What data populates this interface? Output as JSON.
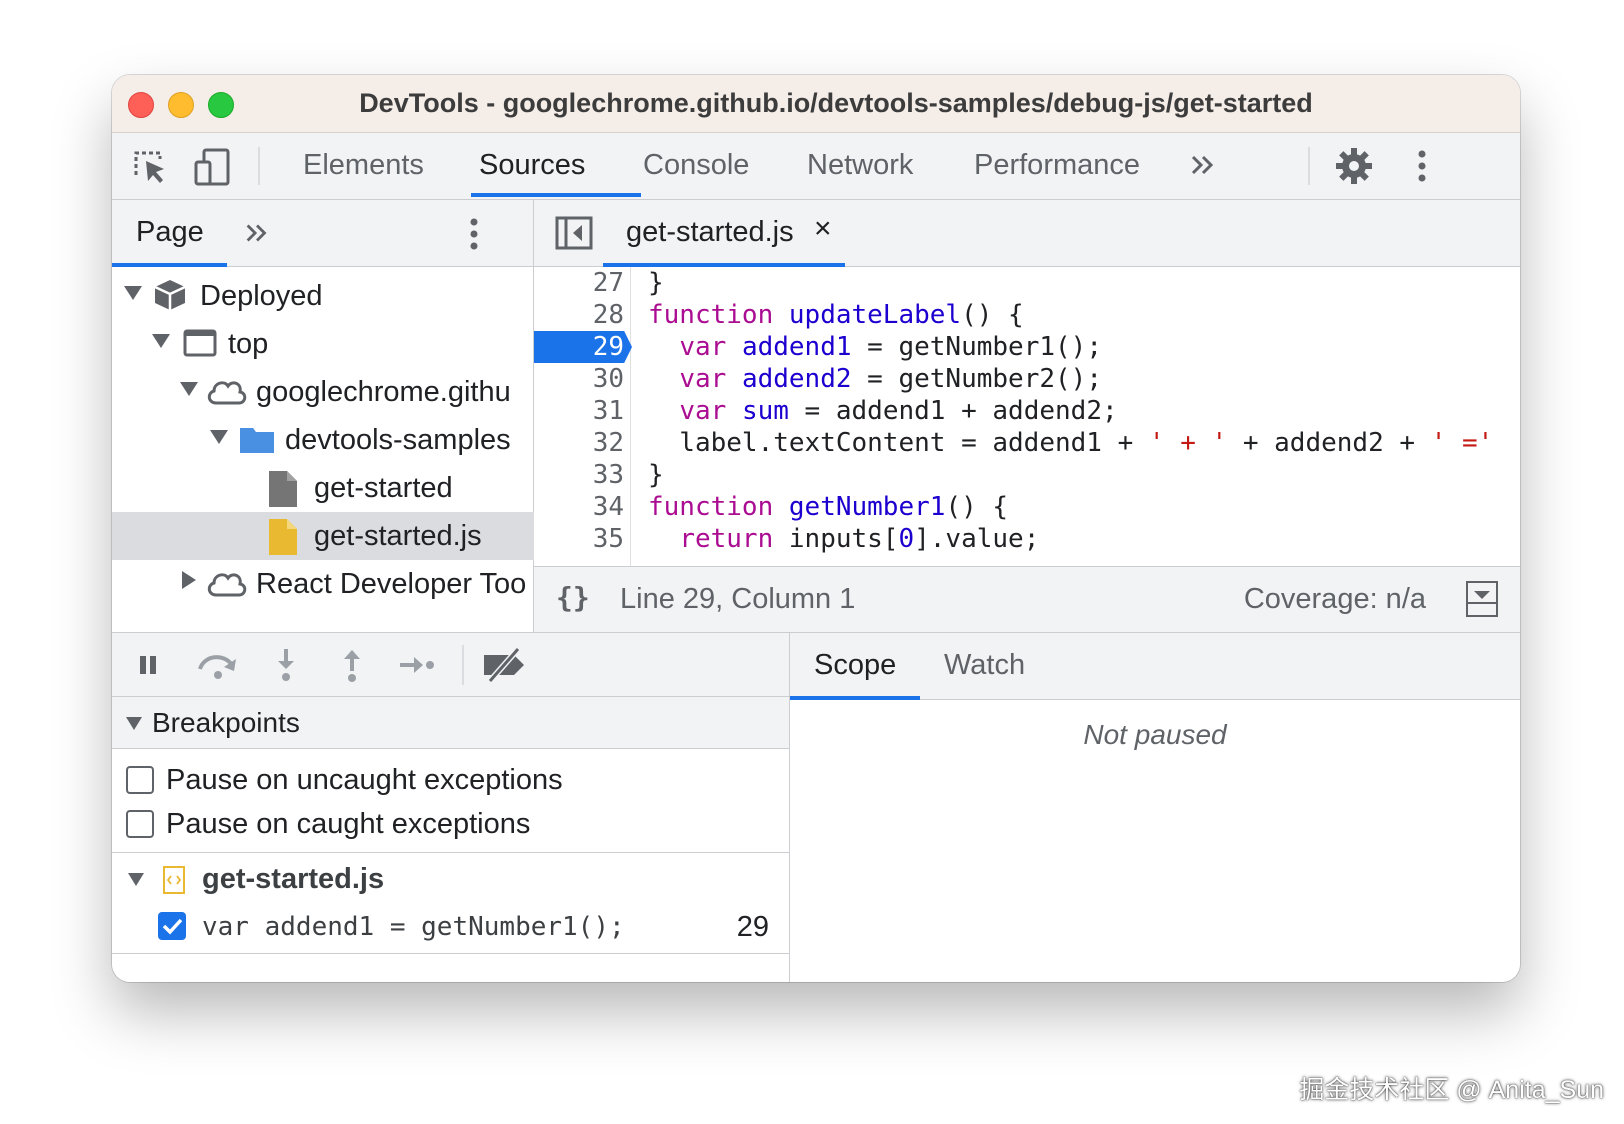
{
  "window": {
    "title": "DevTools - googlechrome.github.io/devtools-samples/debug-js/get-started"
  },
  "toolbar": {
    "tabs": [
      "Elements",
      "Sources",
      "Console",
      "Network",
      "Performance"
    ],
    "active_tab": "Sources",
    "more_tabs_icon": "chevron-double-right-icon",
    "settings_icon": "gear-icon",
    "menu_icon": "kebab-menu-icon"
  },
  "navigator": {
    "tab_label": "Page",
    "more_icon": "chevron-double-right-icon",
    "tree": [
      {
        "label": "Deployed",
        "icon": "cube-icon",
        "expanded": true
      },
      {
        "label": "top",
        "icon": "frame-icon",
        "expanded": true
      },
      {
        "label": "googlechrome.githu",
        "icon": "cloud-icon",
        "expanded": true
      },
      {
        "label": "devtools-samples",
        "icon": "folder-icon",
        "expanded": true
      },
      {
        "label": "get-started",
        "icon": "file-icon"
      },
      {
        "label": "get-started.js",
        "icon": "js-file-icon",
        "selected": true
      },
      {
        "label": "React Developer Too",
        "icon": "cloud-icon",
        "expanded": false
      }
    ]
  },
  "editor": {
    "open_file": "get-started.js",
    "close_glyph": "×",
    "breakpoint_line": 29,
    "lines": [
      {
        "n": "27",
        "text": "}"
      },
      {
        "n": "28",
        "text": "function updateLabel() {"
      },
      {
        "n": "29",
        "text": "  var addend1 = getNumber1();"
      },
      {
        "n": "30",
        "text": "  var addend2 = getNumber2();"
      },
      {
        "n": "31",
        "text": "  var sum = addend1 + addend2;"
      },
      {
        "n": "32",
        "text": "  label.textContent = addend1 + ' + ' + addend2 + ' ="
      },
      {
        "n": "33",
        "text": "}"
      },
      {
        "n": "34",
        "text": "function getNumber1() {"
      },
      {
        "n": "35",
        "text": "  return inputs[0].value;"
      }
    ],
    "status": {
      "braces": "{}",
      "position": "Line 29, Column 1",
      "coverage": "Coverage: n/a"
    }
  },
  "debugger": {
    "controls": [
      "pause-icon",
      "step-over-icon",
      "step-into-icon",
      "step-out-icon",
      "step-icon",
      "deactivate-breakpoints-icon"
    ],
    "breakpoints_header": "Breakpoints",
    "exceptions": [
      {
        "label": "Pause on uncaught exceptions",
        "checked": false
      },
      {
        "label": "Pause on caught exceptions",
        "checked": false
      }
    ],
    "file_group": "get-started.js",
    "breakpoint_entry": {
      "code": "var addend1 = getNumber1();",
      "line": "29",
      "checked": true
    }
  },
  "scope": {
    "tabs": [
      "Scope",
      "Watch"
    ],
    "active_tab": "Scope",
    "message": "Not paused"
  },
  "watermark": "掘金技术社区 @ Anita_Sun",
  "colors": {
    "accent": "#1a73e8",
    "keyword": "#aa0d91",
    "identifier": "#1c00cf",
    "string": "#c41a16"
  }
}
